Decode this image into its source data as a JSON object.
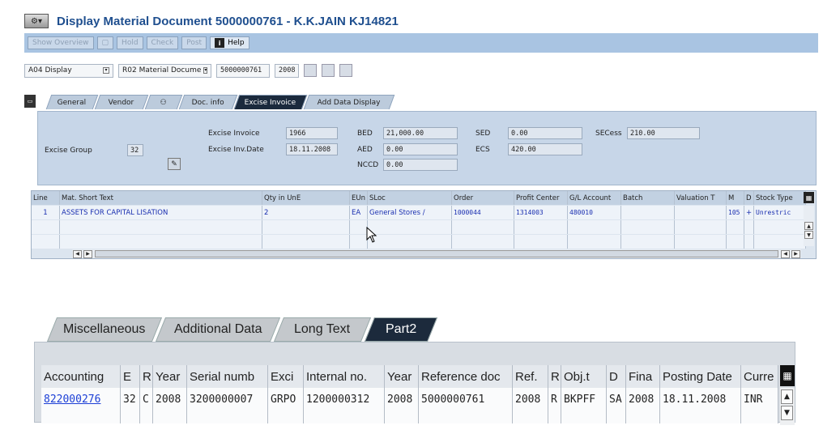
{
  "title": "Display Material Document 5000000761 - K.K.JAIN KJ14821",
  "toolbar": {
    "show_overview": "Show Overview",
    "hold": "Hold",
    "check": "Check",
    "post": "Post",
    "help": "Help"
  },
  "selection": {
    "action": "A04 Display",
    "reference": "R02 Material Docume",
    "doc_number": "5000000761",
    "year": "2008"
  },
  "tabs_top": [
    "General",
    "Vendor",
    "Doc. info",
    "Excise Invoice",
    "Add Data Display"
  ],
  "excise": {
    "group_label": "Excise Group",
    "group_value": "32",
    "invoice_label": "Excise Invoice",
    "invoice_value": "1966",
    "inv_date_label": "Excise Inv.Date",
    "inv_date_value": "18.11.2008",
    "bed_label": "BED",
    "bed_value": "21,000.00",
    "aed_label": "AED",
    "aed_value": "0.00",
    "nccd_label": "NCCD",
    "nccd_value": "0.00",
    "sed_label": "SED",
    "sed_value": "0.00",
    "ecs_label": "ECS",
    "ecs_value": "420.00",
    "secess_label": "SECess",
    "secess_value": "210.00"
  },
  "items_table": {
    "headers": [
      "Line",
      "Mat. Short Text",
      "Qty in UnE",
      "EUn",
      "SLoc",
      "Order",
      "Profit Center",
      "G/L Account",
      "Batch",
      "Valuation T",
      "M",
      "D",
      "Stock Type"
    ],
    "rows": [
      [
        "1",
        "ASSETS FOR CAPITAL LISATION",
        "2",
        "EA",
        "General Stores /",
        "1000044",
        "1314003",
        "480010",
        "",
        "",
        "105",
        "+",
        "Unrestric"
      ]
    ]
  },
  "tabs_bottom": [
    "Miscellaneous",
    "Additional Data",
    "Long Text",
    "Part2"
  ],
  "part2_table": {
    "headers": [
      "Accounting",
      "E",
      "R",
      "Year",
      "Serial numb",
      "Exci",
      "Internal no.",
      "Year",
      "Reference doc",
      "Ref.",
      "R",
      "Obj.t",
      "D",
      "Fina",
      "Posting Date",
      "Curre"
    ],
    "rows": [
      [
        "822000276",
        "32",
        "C",
        "2008",
        "3200000007",
        "GRPO",
        "1200000312",
        "2008",
        "5000000761",
        "2008",
        "R",
        "BKPFF",
        "SA",
        "2008",
        "18.11.2008",
        "INR"
      ]
    ]
  },
  "colors": {
    "title": "#1f4f8f",
    "toolbar_bg": "#a9c4e2",
    "panel_bg": "#c7d6e8",
    "active_tab": "#1b2a3d",
    "link": "#1c3fd6"
  }
}
